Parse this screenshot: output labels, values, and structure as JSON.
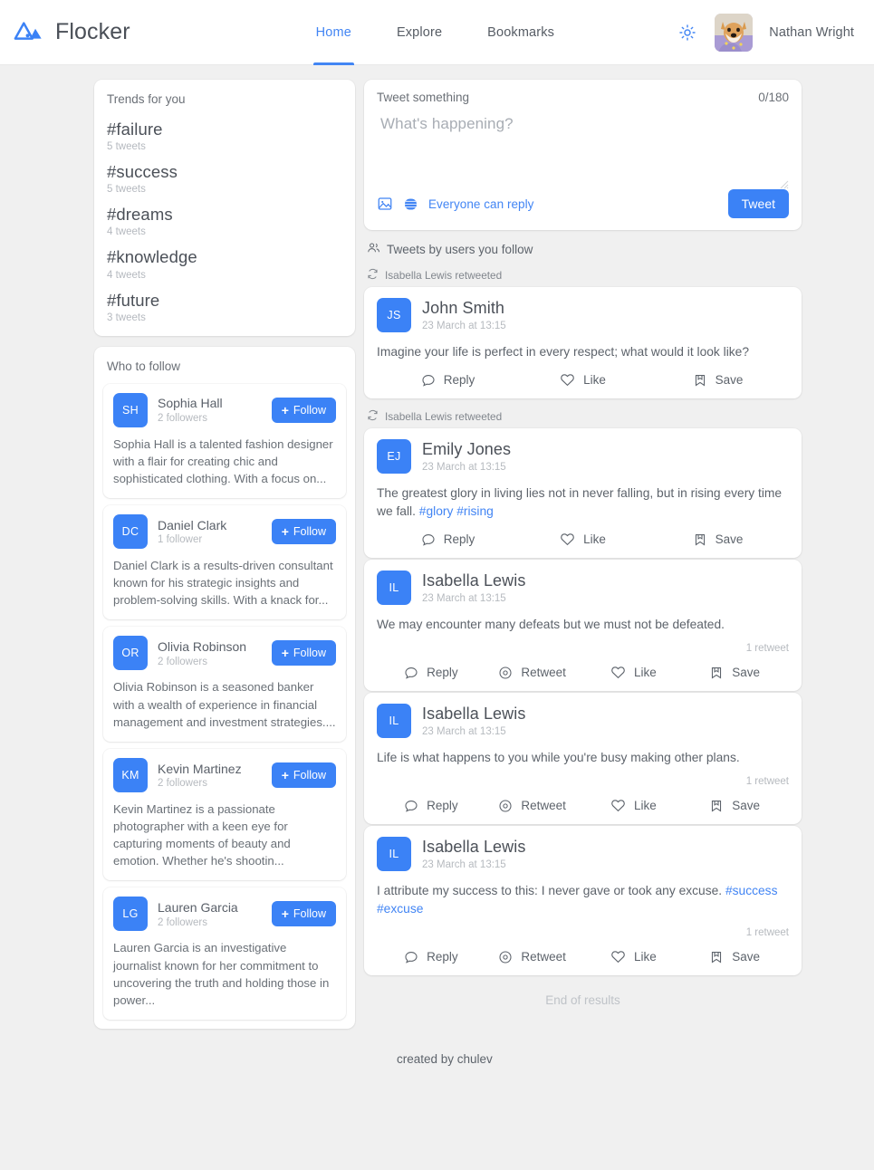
{
  "app": {
    "brand_name": "Flocker",
    "logo_icon": "mountain-logo-icon",
    "accent_color": "#3b82f6",
    "nav_active_color": "#4285f4",
    "background_color": "#f0f0f0"
  },
  "nav": {
    "items": [
      {
        "label": "Home",
        "active": true
      },
      {
        "label": "Explore",
        "active": false
      },
      {
        "label": "Bookmarks",
        "active": false
      }
    ]
  },
  "account": {
    "theme_toggle_icon": "sun-icon",
    "avatar_icon": "shiba-dog-avatar",
    "username": "Nathan Wright"
  },
  "trends": {
    "title": "Trends for you",
    "items": [
      {
        "tag": "#failure",
        "count": "5 tweets"
      },
      {
        "tag": "#success",
        "count": "5 tweets"
      },
      {
        "tag": "#dreams",
        "count": "4 tweets"
      },
      {
        "tag": "#knowledge",
        "count": "4 tweets"
      },
      {
        "tag": "#future",
        "count": "3 tweets"
      }
    ]
  },
  "who_to_follow": {
    "title": "Who to follow",
    "follow_label": "Follow",
    "follow_icon": "plus-icon",
    "items": [
      {
        "initials": "SH",
        "name": "Sophia Hall",
        "followers": "2 followers",
        "bio": "Sophia Hall is a talented fashion designer with a flair for creating chic and sophisticated clothing. With a focus on..."
      },
      {
        "initials": "DC",
        "name": "Daniel Clark",
        "followers": "1 follower",
        "bio": "Daniel Clark is a results-driven consultant known for his strategic insights and problem-solving skills. With a knack for..."
      },
      {
        "initials": "OR",
        "name": "Olivia Robinson",
        "followers": "2 followers",
        "bio": "Olivia Robinson is a seasoned banker with a wealth of experience in financial management and investment strategies...."
      },
      {
        "initials": "KM",
        "name": "Kevin Martinez",
        "followers": "2 followers",
        "bio": "Kevin Martinez is a passionate photographer with a keen eye for capturing moments of beauty and emotion. Whether he's shootin..."
      },
      {
        "initials": "LG",
        "name": "Lauren Garcia",
        "followers": "2 followers",
        "bio": "Lauren Garcia is an investigative journalist known for her commitment to uncovering the truth and holding those in power..."
      }
    ]
  },
  "composer": {
    "label": "Tweet something",
    "counter": "0/180",
    "placeholder": "What's happening?",
    "image_icon": "image-icon",
    "globe_icon": "globe-icon",
    "reply_scope": "Everyone can reply",
    "tweet_button": "Tweet"
  },
  "feed": {
    "header_icon": "people-icon",
    "header_label": "Tweets by users you follow",
    "retweet_icon": "retweet-arrows-icon",
    "end_label": "End of results",
    "tweets": [
      {
        "retweeted_by": "Isabella Lewis retweeted",
        "initials": "JS",
        "name": "John Smith",
        "time": "23 March at 13:15",
        "body": "Imagine your life is perfect in every respect; what would it look like?",
        "tags": [],
        "retweet_count": "",
        "actions": [
          {
            "label": "Reply",
            "icon": "speech-bubble-icon"
          },
          {
            "label": "Like",
            "icon": "heart-icon"
          },
          {
            "label": "Save",
            "icon": "bookmark-icon"
          }
        ]
      },
      {
        "retweeted_by": "Isabella Lewis retweeted",
        "initials": "EJ",
        "name": "Emily Jones",
        "time": "23 March at 13:15",
        "body": "The greatest glory in living lies not in never falling, but in rising every time we fall. ",
        "tags": [
          "#glory",
          "#rising"
        ],
        "retweet_count": "",
        "actions": [
          {
            "label": "Reply",
            "icon": "speech-bubble-icon"
          },
          {
            "label": "Like",
            "icon": "heart-icon"
          },
          {
            "label": "Save",
            "icon": "bookmark-icon"
          }
        ]
      },
      {
        "retweeted_by": "",
        "initials": "IL",
        "name": "Isabella Lewis",
        "time": "23 March at 13:15",
        "body": "We may encounter many defeats but we must not be defeated.",
        "tags": [],
        "retweet_count": "1 retweet",
        "actions": [
          {
            "label": "Reply",
            "icon": "speech-bubble-icon"
          },
          {
            "label": "Retweet",
            "icon": "retweet-circle-icon"
          },
          {
            "label": "Like",
            "icon": "heart-icon"
          },
          {
            "label": "Save",
            "icon": "bookmark-icon"
          }
        ]
      },
      {
        "retweeted_by": "",
        "initials": "IL",
        "name": "Isabella Lewis",
        "time": "23 March at 13:15",
        "body": "Life is what happens to you while you're busy making other plans.",
        "tags": [],
        "retweet_count": "1 retweet",
        "actions": [
          {
            "label": "Reply",
            "icon": "speech-bubble-icon"
          },
          {
            "label": "Retweet",
            "icon": "retweet-circle-icon"
          },
          {
            "label": "Like",
            "icon": "heart-icon"
          },
          {
            "label": "Save",
            "icon": "bookmark-icon"
          }
        ]
      },
      {
        "retweeted_by": "",
        "initials": "IL",
        "name": "Isabella Lewis",
        "time": "23 March at 13:15",
        "body": "I attribute my success to this: I never gave or took any excuse. ",
        "tags": [
          "#success",
          "#excuse"
        ],
        "retweet_count": "1 retweet",
        "actions": [
          {
            "label": "Reply",
            "icon": "speech-bubble-icon"
          },
          {
            "label": "Retweet",
            "icon": "retweet-circle-icon"
          },
          {
            "label": "Like",
            "icon": "heart-icon"
          },
          {
            "label": "Save",
            "icon": "bookmark-icon"
          }
        ]
      }
    ]
  },
  "footer": {
    "credit": "created by chulev"
  }
}
